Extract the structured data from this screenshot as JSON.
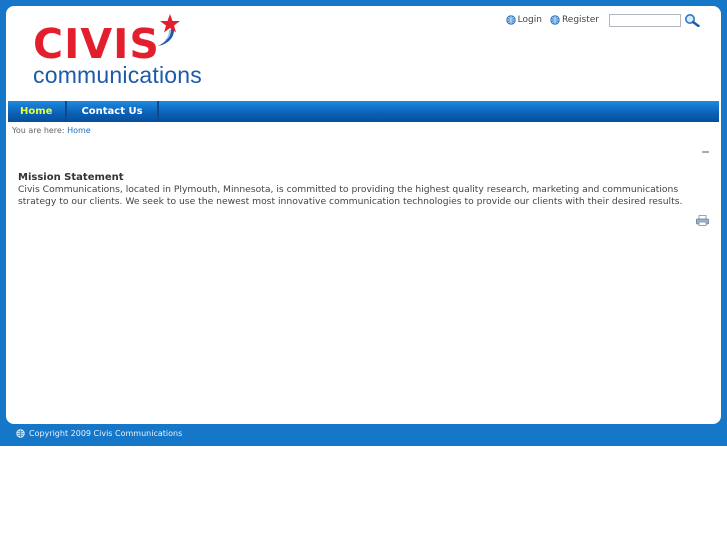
{
  "brand": {
    "name": "CIVIS",
    "tagline": "communications",
    "colors": {
      "red": "#e31e2d",
      "blue": "#1d5aa8",
      "frame": "#1677c8"
    }
  },
  "header": {
    "login_label": "Login",
    "register_label": "Register",
    "search_placeholder": ""
  },
  "nav": {
    "items": [
      {
        "label": "Home"
      },
      {
        "label": "Contact Us"
      }
    ]
  },
  "breadcrumb": {
    "prefix": "You are here:",
    "current": "Home"
  },
  "article": {
    "title": "Mission Statement",
    "body": "Civis Communications, located in Plymouth, Minnesota, is committed to providing the highest quality research, marketing and communications strategy to our clients. We seek to use the newest most innovative communication technologies to provide our clients with their desired results."
  },
  "footer": {
    "copyright": "Copyright 2009 Civis Communications"
  }
}
